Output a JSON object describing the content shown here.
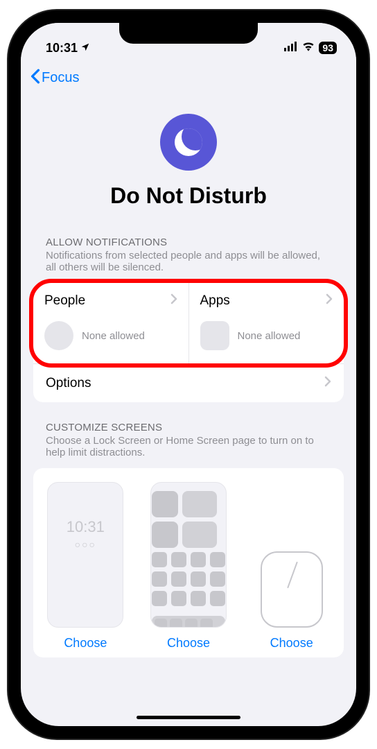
{
  "status": {
    "time": "10:31",
    "location_icon": "location-arrow-icon",
    "battery_percent": "93"
  },
  "nav": {
    "back_label": "Focus"
  },
  "hero": {
    "title": "Do Not Disturb",
    "icon": "moon-icon"
  },
  "sections": {
    "allow": {
      "header": "ALLOW NOTIFICATIONS",
      "subtitle": "Notifications from selected people and apps will be allowed, all others will be silenced.",
      "people": {
        "title": "People",
        "status": "None allowed"
      },
      "apps": {
        "title": "Apps",
        "status": "None allowed"
      },
      "options": {
        "title": "Options"
      }
    },
    "customize": {
      "header": "CUSTOMIZE SCREENS",
      "subtitle": "Choose a Lock Screen or Home Screen page to turn on to help limit distractions.",
      "lock": {
        "time": "10:31",
        "choose": "Choose"
      },
      "home": {
        "choose": "Choose"
      },
      "watch": {
        "choose": "Choose"
      }
    }
  }
}
